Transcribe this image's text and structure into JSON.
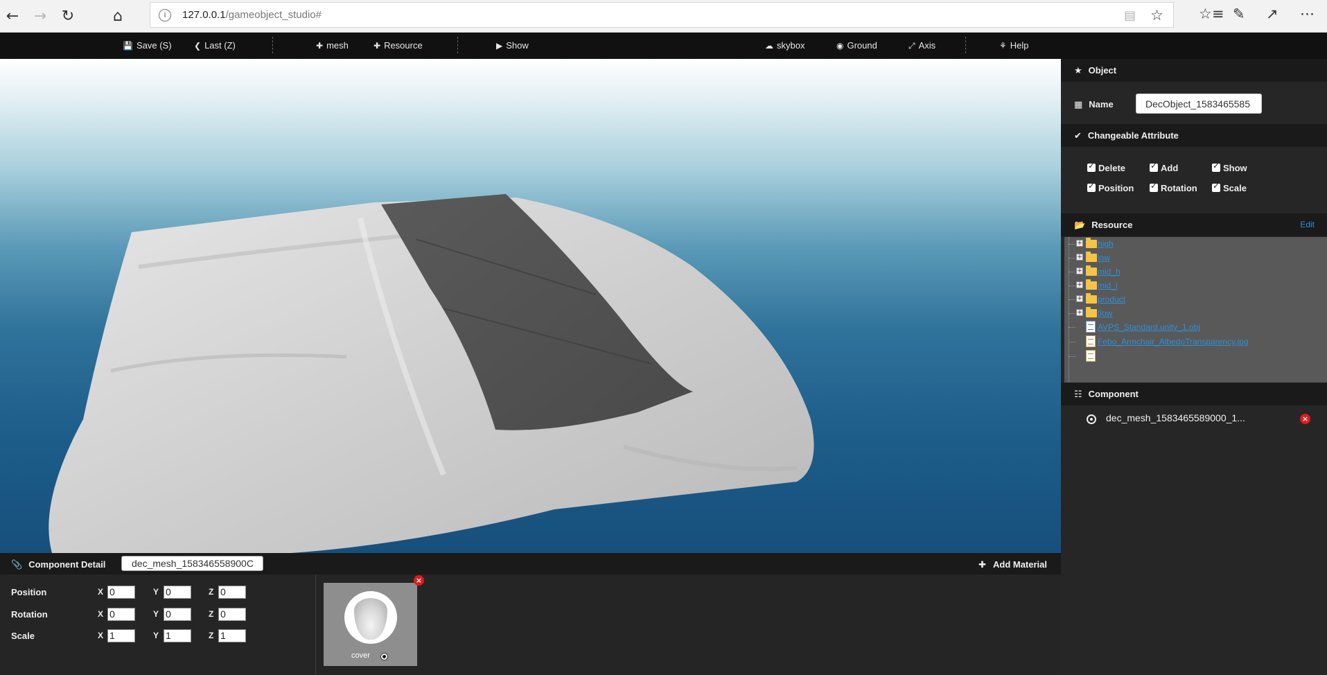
{
  "browser": {
    "url_host": "127.0.0.1",
    "url_path": "/gameobject_studio#",
    "icons": [
      "back-icon",
      "forward-icon",
      "refresh-icon",
      "home-icon",
      "info-icon",
      "reading-view-icon",
      "favorite-star-icon",
      "favorites-list-icon",
      "pen-icon",
      "share-icon",
      "more-icon"
    ]
  },
  "toolbar": {
    "save": "Save (S)",
    "last": "Last (Z)",
    "mesh": "mesh",
    "resource": "Resource",
    "show": "Show",
    "skybox": "skybox",
    "ground": "Ground",
    "axis": "Axis",
    "help": "Help"
  },
  "object_panel": {
    "header": "Object",
    "name_label": "Name",
    "name_value": "DecObject_1583465585"
  },
  "attributes": {
    "header": "Changeable Attribute",
    "items": [
      "Delete",
      "Add",
      "Show",
      "Position",
      "Rotation",
      "Scale"
    ]
  },
  "resource": {
    "header": "Resource",
    "edit": "Edit",
    "tree": [
      {
        "label": "high",
        "kind": "folder"
      },
      {
        "label": "low",
        "kind": "folder"
      },
      {
        "label": "mid_h",
        "kind": "folder"
      },
      {
        "label": "mid_l",
        "kind": "folder"
      },
      {
        "label": "product",
        "kind": "folder"
      },
      {
        "label": "tlow",
        "kind": "folder"
      },
      {
        "label": "AVPS_Standard.unity_1.obj",
        "kind": "file"
      },
      {
        "label": "Febo_Armchair_AlbedoTransparency.jpg",
        "kind": "image"
      }
    ]
  },
  "component": {
    "header": "Component",
    "item": "dec_mesh_1583465589000_1..."
  },
  "component_detail": {
    "title": "Component Detail",
    "name_value": "dec_mesh_158346558900C",
    "add_material": "Add Material",
    "position": {
      "label": "Position",
      "x": "0",
      "y": "0",
      "z": "0"
    },
    "rotation": {
      "label": "Rotation",
      "x": "0",
      "y": "0",
      "z": "0"
    },
    "scale": {
      "label": "Scale",
      "x": "1",
      "y": "1",
      "z": "1"
    },
    "axis_x": "X",
    "axis_y": "Y",
    "axis_z": "Z",
    "material": {
      "label": "cover"
    }
  },
  "colors": {
    "toolbar_bg": "#111111",
    "panel_bg": "#262626",
    "link_blue": "#2e8fd9",
    "delete_red": "#e01b1b"
  }
}
